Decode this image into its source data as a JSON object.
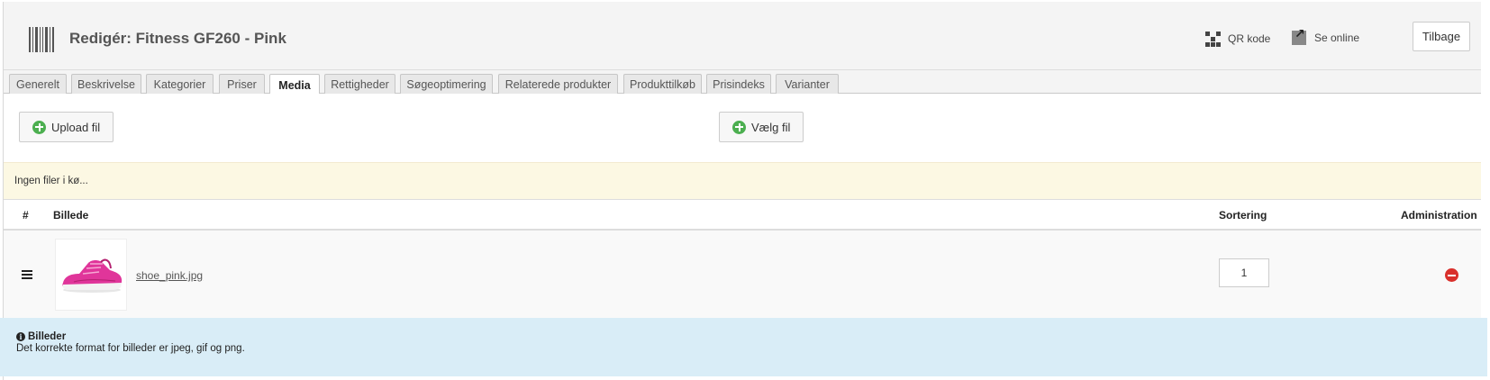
{
  "header": {
    "title": "Redigér: Fitness GF260 - Pink",
    "qr_label": "QR kode",
    "online_label": "Se online",
    "back_label": "Tilbage"
  },
  "tabs": [
    {
      "label": "Generelt"
    },
    {
      "label": "Beskrivelse"
    },
    {
      "label": "Kategorier"
    },
    {
      "label": "Priser"
    },
    {
      "label": "Media",
      "active": true
    },
    {
      "label": "Rettigheder"
    },
    {
      "label": "Søgeoptimering"
    },
    {
      "label": "Relaterede produkter"
    },
    {
      "label": "Produkttilkøb"
    },
    {
      "label": "Prisindeks"
    },
    {
      "label": "Varianter"
    }
  ],
  "upload": {
    "upload_label": "Upload fil",
    "choose_label": "Vælg fil",
    "queue_text": "Ingen filer i kø..."
  },
  "table": {
    "headers": {
      "number": "#",
      "image": "Billede",
      "sort": "Sortering",
      "admin": "Administration"
    },
    "rows": [
      {
        "file": "shoe_pink.jpg",
        "sort": "1"
      }
    ]
  },
  "info": {
    "title": "Billeder",
    "text": "Det korrekte format for billeder er jpeg, gif og png."
  },
  "colors": {
    "header_bg": "#f4f4f4",
    "queue_bg": "#fcf8e3",
    "info_bg": "#d9edf7",
    "add_green": "#4caf50",
    "remove_red": "#d9302c"
  }
}
